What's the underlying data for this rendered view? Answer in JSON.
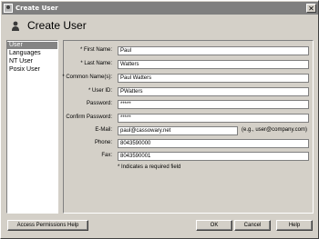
{
  "window": {
    "title": "Create User",
    "close_glyph": "✕"
  },
  "header": {
    "title": "Create User",
    "icon": "user-icon"
  },
  "nav": {
    "items": [
      {
        "label": "User",
        "selected": true
      },
      {
        "label": "Languages",
        "selected": false
      },
      {
        "label": "NT User",
        "selected": false
      },
      {
        "label": "Posix User",
        "selected": false
      }
    ]
  },
  "form": {
    "fields": [
      {
        "label": "* First Name:",
        "value": "Paul"
      },
      {
        "label": "* Last Name:",
        "value": "Watters"
      },
      {
        "label": "* Common Name(s):",
        "value": "Paul Watters"
      },
      {
        "label": "* User ID:",
        "value": "PWatters"
      },
      {
        "label": "Password:",
        "value": "*****"
      },
      {
        "label": "Confirm Password:",
        "value": "*****"
      },
      {
        "label": "E-Mail:",
        "value": "paul@cassowary.net",
        "hint": "(e.g., user@company.com)"
      },
      {
        "label": "Phone:",
        "value": "8043590000"
      },
      {
        "label": "Fax:",
        "value": "8043590001"
      }
    ],
    "required_note": "* Indicates a required field"
  },
  "buttons": {
    "access_permissions_help": "Access Permissions Help",
    "ok": "OK",
    "cancel": "Cancel",
    "help": "Help"
  },
  "colors": {
    "title_bar": "#7f7f7f",
    "window_bg": "#d4d0c8",
    "selection": "#848484"
  }
}
